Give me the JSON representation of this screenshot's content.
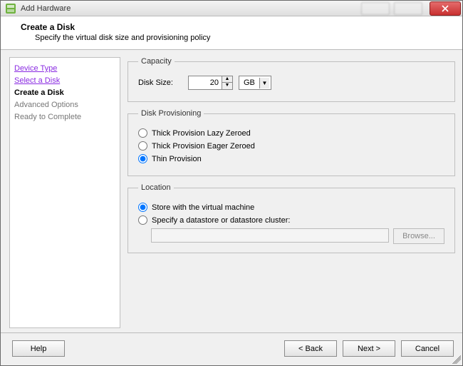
{
  "window": {
    "title": "Add Hardware"
  },
  "header": {
    "title": "Create a Disk",
    "subtitle": "Specify the virtual disk size and provisioning policy"
  },
  "sidebar": {
    "items": [
      {
        "label": "Device Type",
        "state": "link"
      },
      {
        "label": "Select a Disk",
        "state": "link"
      },
      {
        "label": "Create a Disk",
        "state": "current"
      },
      {
        "label": "Advanced Options",
        "state": "disabled"
      },
      {
        "label": "Ready to Complete",
        "state": "disabled"
      }
    ]
  },
  "capacity": {
    "legend": "Capacity",
    "disk_size_label": "Disk Size:",
    "disk_size_value": "20",
    "unit": "GB"
  },
  "provisioning": {
    "legend": "Disk Provisioning",
    "options": [
      {
        "label": "Thick Provision Lazy Zeroed",
        "selected": false
      },
      {
        "label": "Thick Provision Eager Zeroed",
        "selected": false
      },
      {
        "label": "Thin Provision",
        "selected": true
      }
    ]
  },
  "location": {
    "legend": "Location",
    "options": [
      {
        "label": "Store with the virtual machine",
        "selected": true
      },
      {
        "label": "Specify a datastore or datastore cluster:",
        "selected": false
      }
    ],
    "datastore_value": "",
    "browse_label": "Browse..."
  },
  "footer": {
    "help": "Help",
    "back": "< Back",
    "next": "Next >",
    "cancel": "Cancel"
  }
}
